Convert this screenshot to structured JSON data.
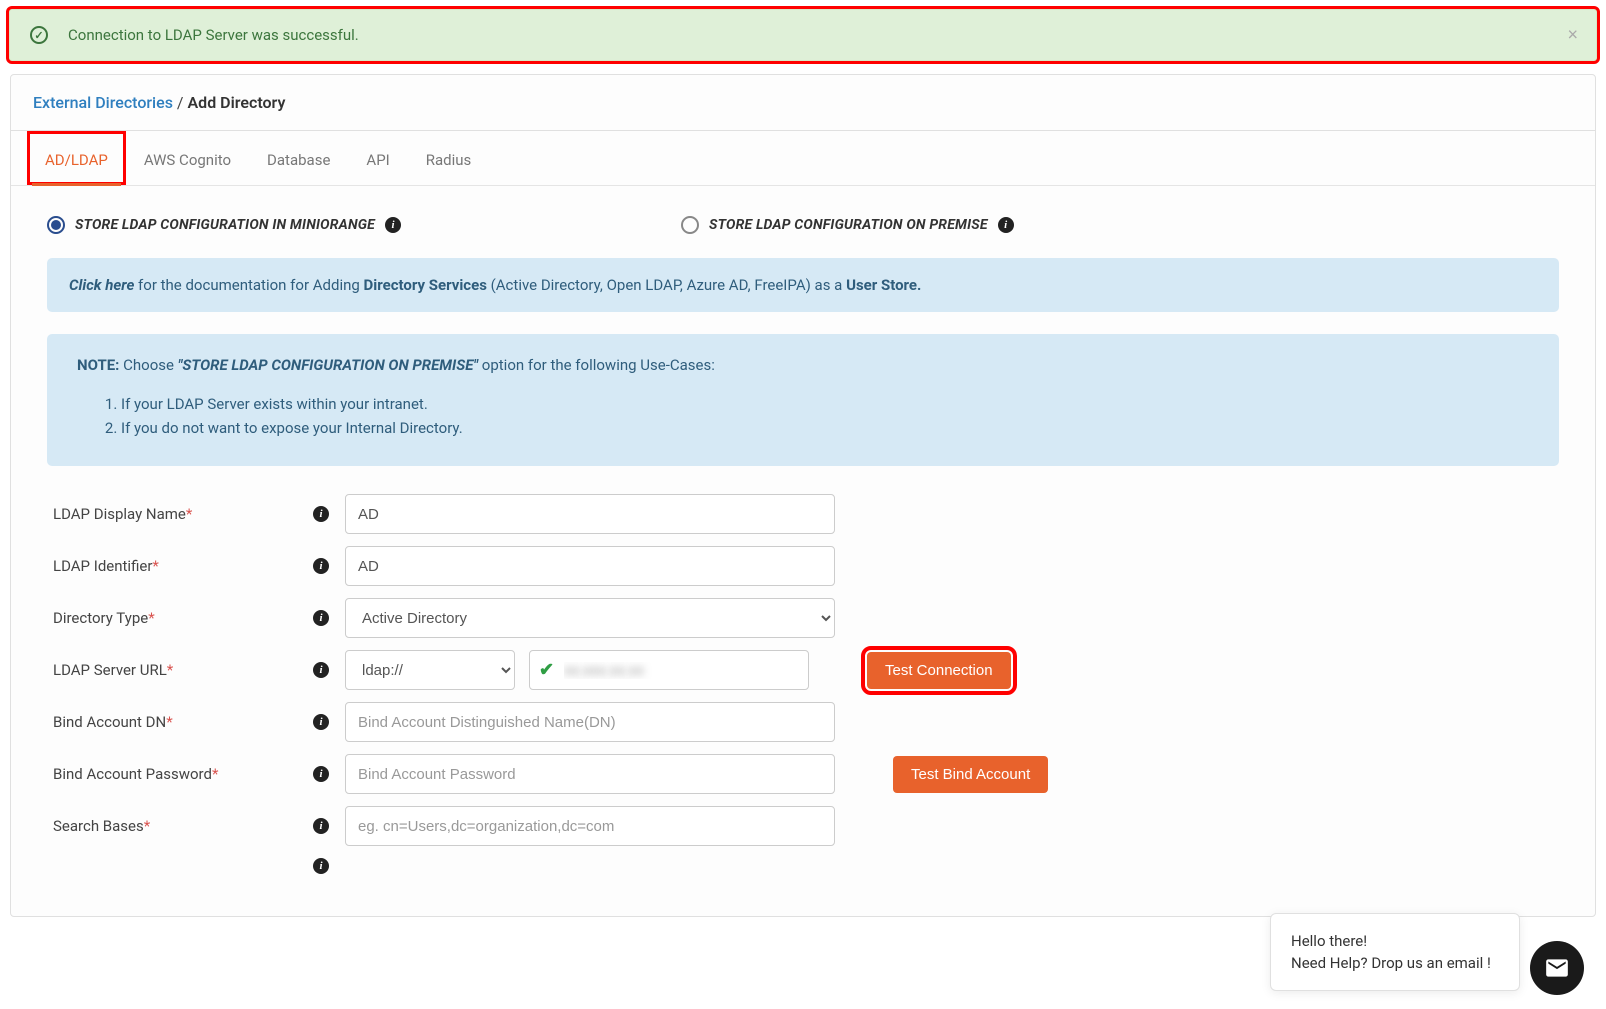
{
  "alert": {
    "message": "Connection to LDAP Server was successful."
  },
  "breadcrumb": {
    "parent": "External Directories",
    "sep": "/",
    "current": "Add Directory"
  },
  "tabs": [
    "AD/LDAP",
    "AWS Cognito",
    "Database",
    "API",
    "Radius"
  ],
  "radios": {
    "miniorange": "STORE LDAP CONFIGURATION IN MINIORANGE",
    "onpremise": "STORE LDAP CONFIGURATION ON PREMISE"
  },
  "docbox": {
    "link": "Click here",
    "pre": " for the documentation for Adding ",
    "bold1": "Directory Services",
    "mid": " (Active Directory, Open LDAP, Azure AD, FreeIPA) as a ",
    "bold2": "User Store."
  },
  "notebox": {
    "note": "NOTE:",
    "lead": "  Choose  ",
    "quoted": "\"STORE LDAP CONFIGURATION ON PREMISE\"",
    "tail": " option for the following Use-Cases:",
    "li1": "If your LDAP Server exists within your intranet.",
    "li2": "If you do not want to expose your Internal Directory."
  },
  "form": {
    "display_name": {
      "label": "LDAP Display Name",
      "value": "AD"
    },
    "identifier": {
      "label": "LDAP Identifier",
      "value": "AD"
    },
    "dir_type": {
      "label": "Directory Type",
      "value": "Active Directory"
    },
    "server_url": {
      "label": "LDAP Server URL",
      "scheme": "ldap://",
      "host_masked": "xx.xxx.xx.xx"
    },
    "bind_dn": {
      "label": "Bind Account DN",
      "placeholder": "Bind Account Distinguished Name(DN)"
    },
    "bind_pw": {
      "label": "Bind Account Password",
      "placeholder": "Bind Account Password"
    },
    "search_bases": {
      "label": "Search Bases",
      "placeholder": "eg. cn=Users,dc=organization,dc=com"
    }
  },
  "buttons": {
    "test_connection": "Test Connection",
    "test_bind": "Test Bind Account"
  },
  "chat": {
    "line1": "Hello there!",
    "line2": "Need Help? Drop us an email !"
  }
}
